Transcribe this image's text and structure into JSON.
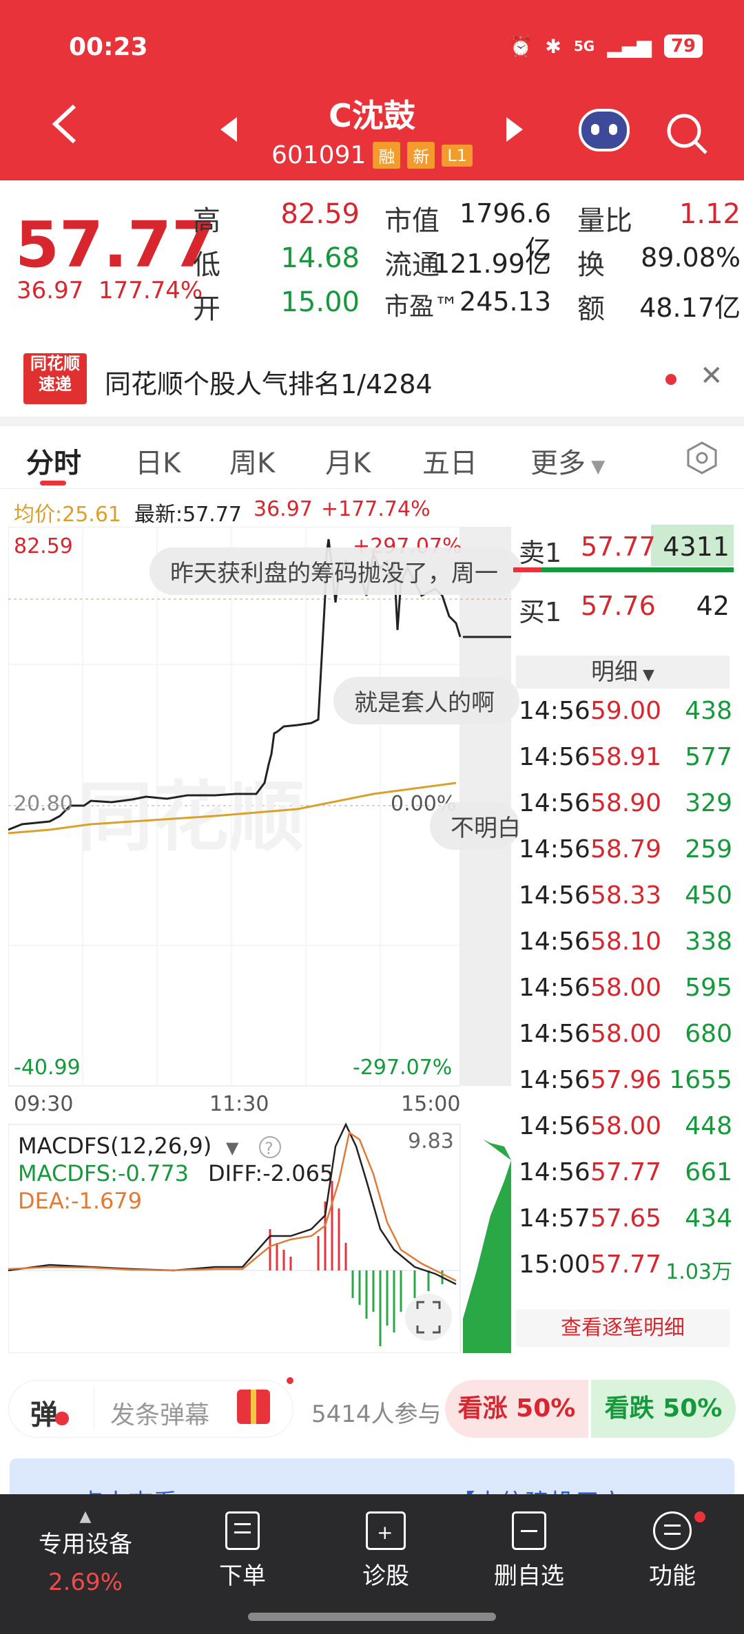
{
  "status": {
    "time": "00:23",
    "battery": "79",
    "net": "5G"
  },
  "header": {
    "name": "C沈鼓",
    "code": "601091",
    "tags": [
      "融",
      "新",
      "L1"
    ]
  },
  "quote": {
    "price": "57.77",
    "change": "36.97",
    "change_pct": "177.74%",
    "labels": {
      "high": "高",
      "low": "低",
      "open": "开",
      "mcap": "市值",
      "float": "流通",
      "pe": "市盈™",
      "vol_ratio": "量比",
      "turnover": "换",
      "amount": "额"
    },
    "high": "82.59",
    "low": "14.68",
    "open": "15.00",
    "mcap": "1796.6亿",
    "float": "121.99亿",
    "pe": "245.13",
    "vol_ratio": "1.12",
    "turnover": "89.08%",
    "amount": "48.17亿"
  },
  "news": {
    "logo_line1": "同花顺",
    "logo_line2": "速递",
    "text": "同花顺个股人气排名1/4284"
  },
  "tabs": [
    "分时",
    "日K",
    "周K",
    "月K",
    "五日",
    "更多"
  ],
  "info": {
    "avg_label": "均价:25.61",
    "latest_label": "最新:57.77",
    "chg": "36.97",
    "pct": "+177.74%"
  },
  "chart": {
    "y_top": "82.59",
    "y_top_pct": "+297.07%",
    "y_mid": "20.80",
    "y_mid_pct": "0.00%",
    "y_bot": "-40.99",
    "y_bot_pct": "-297.07%",
    "x_labels": [
      "09:30",
      "11:30",
      "15:00"
    ],
    "macd_title": "MACDFS(12,26,9)",
    "macd_val": "MACDFS:-0.773",
    "diff": "DIFF:-2.065",
    "dea": "DEA:-1.679",
    "macd_max": "9.83"
  },
  "bubbles": [
    "昨天获利盘的筹码抛没了，周一",
    "就是套人的啊",
    "不明白"
  ],
  "orderbook": {
    "sell1": {
      "label": "卖1",
      "price": "57.77",
      "vol": "4311"
    },
    "buy1": {
      "label": "买1",
      "price": "57.76",
      "vol": "42"
    },
    "detail_label": "明细",
    "ticks": [
      {
        "t": "14:56",
        "p": "59.00",
        "v": "438"
      },
      {
        "t": "14:56",
        "p": "58.91",
        "v": "577"
      },
      {
        "t": "14:56",
        "p": "58.90",
        "v": "329"
      },
      {
        "t": "14:56",
        "p": "58.79",
        "v": "259"
      },
      {
        "t": "14:56",
        "p": "58.33",
        "v": "450"
      },
      {
        "t": "14:56",
        "p": "58.10",
        "v": "338"
      },
      {
        "t": "14:56",
        "p": "58.00",
        "v": "595"
      },
      {
        "t": "14:56",
        "p": "58.00",
        "v": "680"
      },
      {
        "t": "14:56",
        "p": "57.96",
        "v": "1655"
      },
      {
        "t": "14:56",
        "p": "58.00",
        "v": "448"
      },
      {
        "t": "14:56",
        "p": "57.77",
        "v": "661"
      },
      {
        "t": "14:57",
        "p": "57.65",
        "v": "434"
      },
      {
        "t": "15:00",
        "p": "57.77",
        "v": "1.03万"
      }
    ],
    "see_all": "查看逐笔明细"
  },
  "danmu": {
    "label": "弹",
    "placeholder": "发条弹幕",
    "participants": "5414人参与",
    "up": "看涨 50%",
    "down": "看跌 50%"
  },
  "promo": {
    "left": "点击查看>>",
    "right": "【中信建投用户"
  },
  "nav": [
    {
      "label": "专用设备",
      "sub": "2.69%"
    },
    {
      "label": "下单"
    },
    {
      "label": "诊股"
    },
    {
      "label": "删自选"
    },
    {
      "label": "功能"
    }
  ],
  "colors": {
    "brand": "#e8333b",
    "up": "#d8262f",
    "down": "#159a3b",
    "avg": "#d9a12b"
  }
}
